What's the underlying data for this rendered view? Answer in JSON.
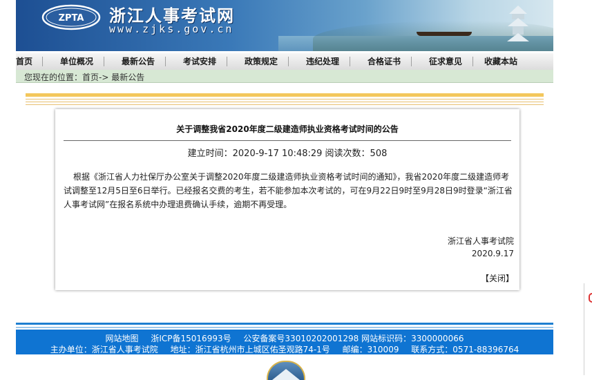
{
  "header": {
    "logo_text": "ZPTA",
    "site_title": "浙江人事考试网",
    "site_url": "www.zjks.gov.cn"
  },
  "nav": {
    "items": [
      {
        "label": "首页"
      },
      {
        "label": "单位概况"
      },
      {
        "label": "最新公告"
      },
      {
        "label": "考试安排"
      },
      {
        "label": "政策规定"
      },
      {
        "label": "违纪处理"
      },
      {
        "label": "合格证书"
      },
      {
        "label": "征求意见"
      },
      {
        "label": "收藏本站"
      }
    ]
  },
  "breadcrumb": {
    "text": "您现在的位置：首页-> 最新公告"
  },
  "article": {
    "title": "关于调整我省2020年度二级建造师执业资格考试时间的公告",
    "meta": "建立时间：2020-9-17 10:48:29 阅读次数：508",
    "body": "根据《浙江省人力社保厅办公室关于调整2020年度二级建造师执业资格考试时间的通知》，我省2020年度二级建造师考试调整至12月5日至6日举行。已经报名交费的考生，若不能参加本次考试的，可在9月22日9时至9月28日9时登录“浙江省人事考试网”在报名系统中办理退费确认手续，逾期不再受理。",
    "signature_org": "浙江省人事考试院",
    "signature_date": "2020.9.17",
    "close_label": "【关闭】"
  },
  "footer": {
    "row1": {
      "sitemap": "网站地图",
      "icp": "浙ICP备15016993号",
      "police": "公安备案号33010202001298 网站标识码：3300000066"
    },
    "row2": {
      "host": "主办单位：浙江省人事考试院",
      "address": "地址：浙江省杭州市上城区佑圣观路74-1号",
      "postcode": "邮编：310009",
      "contact": "联系方式：0571-88396764"
    }
  },
  "colors": {
    "banner": "#1d4f93",
    "footer": "#0f74d2",
    "breadcrumb_bg": "#d7e8d4",
    "stripe": "#f3c75c"
  }
}
